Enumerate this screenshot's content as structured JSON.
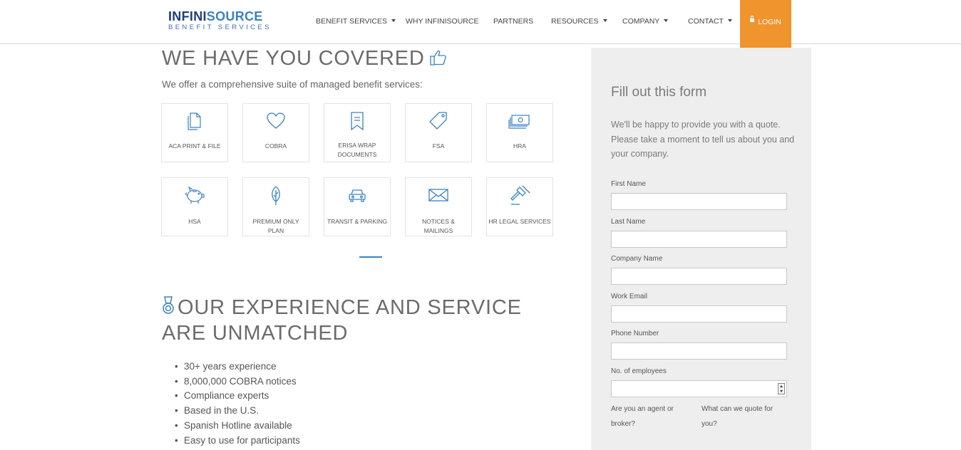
{
  "brand": {
    "name_part1": "INFINI",
    "name_part2": "SOURCE",
    "tagline": "BENEFIT SERVICES",
    "colors": {
      "navy": "#1f3f7a",
      "blue": "#3a82c4",
      "orange": "#f0942e"
    }
  },
  "nav": {
    "items": [
      {
        "label": "BENEFIT SERVICES",
        "dropdown": true
      },
      {
        "label": "WHY INFINISOURCE",
        "dropdown": false
      },
      {
        "label": "PARTNERS",
        "dropdown": false
      },
      {
        "label": "RESOURCES",
        "dropdown": true
      },
      {
        "label": "COMPANY",
        "dropdown": true
      },
      {
        "label": "CONTACT",
        "dropdown": true
      }
    ],
    "login_label": "LOGIN"
  },
  "covered": {
    "heading": "WE HAVE YOU COVERED",
    "intro": "We offer a comprehensive suite of managed benefit services:",
    "tiles": [
      {
        "label": "ACA PRINT & FILE",
        "icon": "documents-icon"
      },
      {
        "label": "COBRA",
        "icon": "heart-icon"
      },
      {
        "label": "ERISA WRAP DOCUMENTS",
        "icon": "bookmark-icon"
      },
      {
        "label": "FSA",
        "icon": "tag-icon"
      },
      {
        "label": "HRA",
        "icon": "money-icon"
      },
      {
        "label": "HSA",
        "icon": "piggy-bank-icon"
      },
      {
        "label": "PREMIUM ONLY PLAN",
        "icon": "leaf-icon"
      },
      {
        "label": "TRANSIT & PARKING",
        "icon": "car-icon"
      },
      {
        "label": "NOTICES & MAILINGS",
        "icon": "envelope-icon"
      },
      {
        "label": "HR LEGAL SERVICES",
        "icon": "gavel-icon"
      }
    ]
  },
  "experience": {
    "heading": "OUR EXPERIENCE AND SERVICE ARE UNMATCHED",
    "bullets": [
      "30+ years experience",
      "8,000,000 COBRA notices",
      "Compliance experts",
      "Based in the U.S.",
      "Spanish Hotline available",
      "Easy to use for participants"
    ]
  },
  "form": {
    "title": "Fill out this form",
    "intro": "We'll be happy to provide you with a quote. Please take a moment to tell us about you and your company.",
    "fields": [
      {
        "label": "First Name",
        "value": ""
      },
      {
        "label": "Last Name",
        "value": ""
      },
      {
        "label": "Company Name",
        "value": ""
      },
      {
        "label": "Work Email",
        "value": ""
      },
      {
        "label": "Phone Number",
        "value": ""
      },
      {
        "label": "No. of employees",
        "value": ""
      }
    ],
    "question_agent": "Are you an agent or broker?",
    "question_quote": "What can we quote for you?"
  }
}
